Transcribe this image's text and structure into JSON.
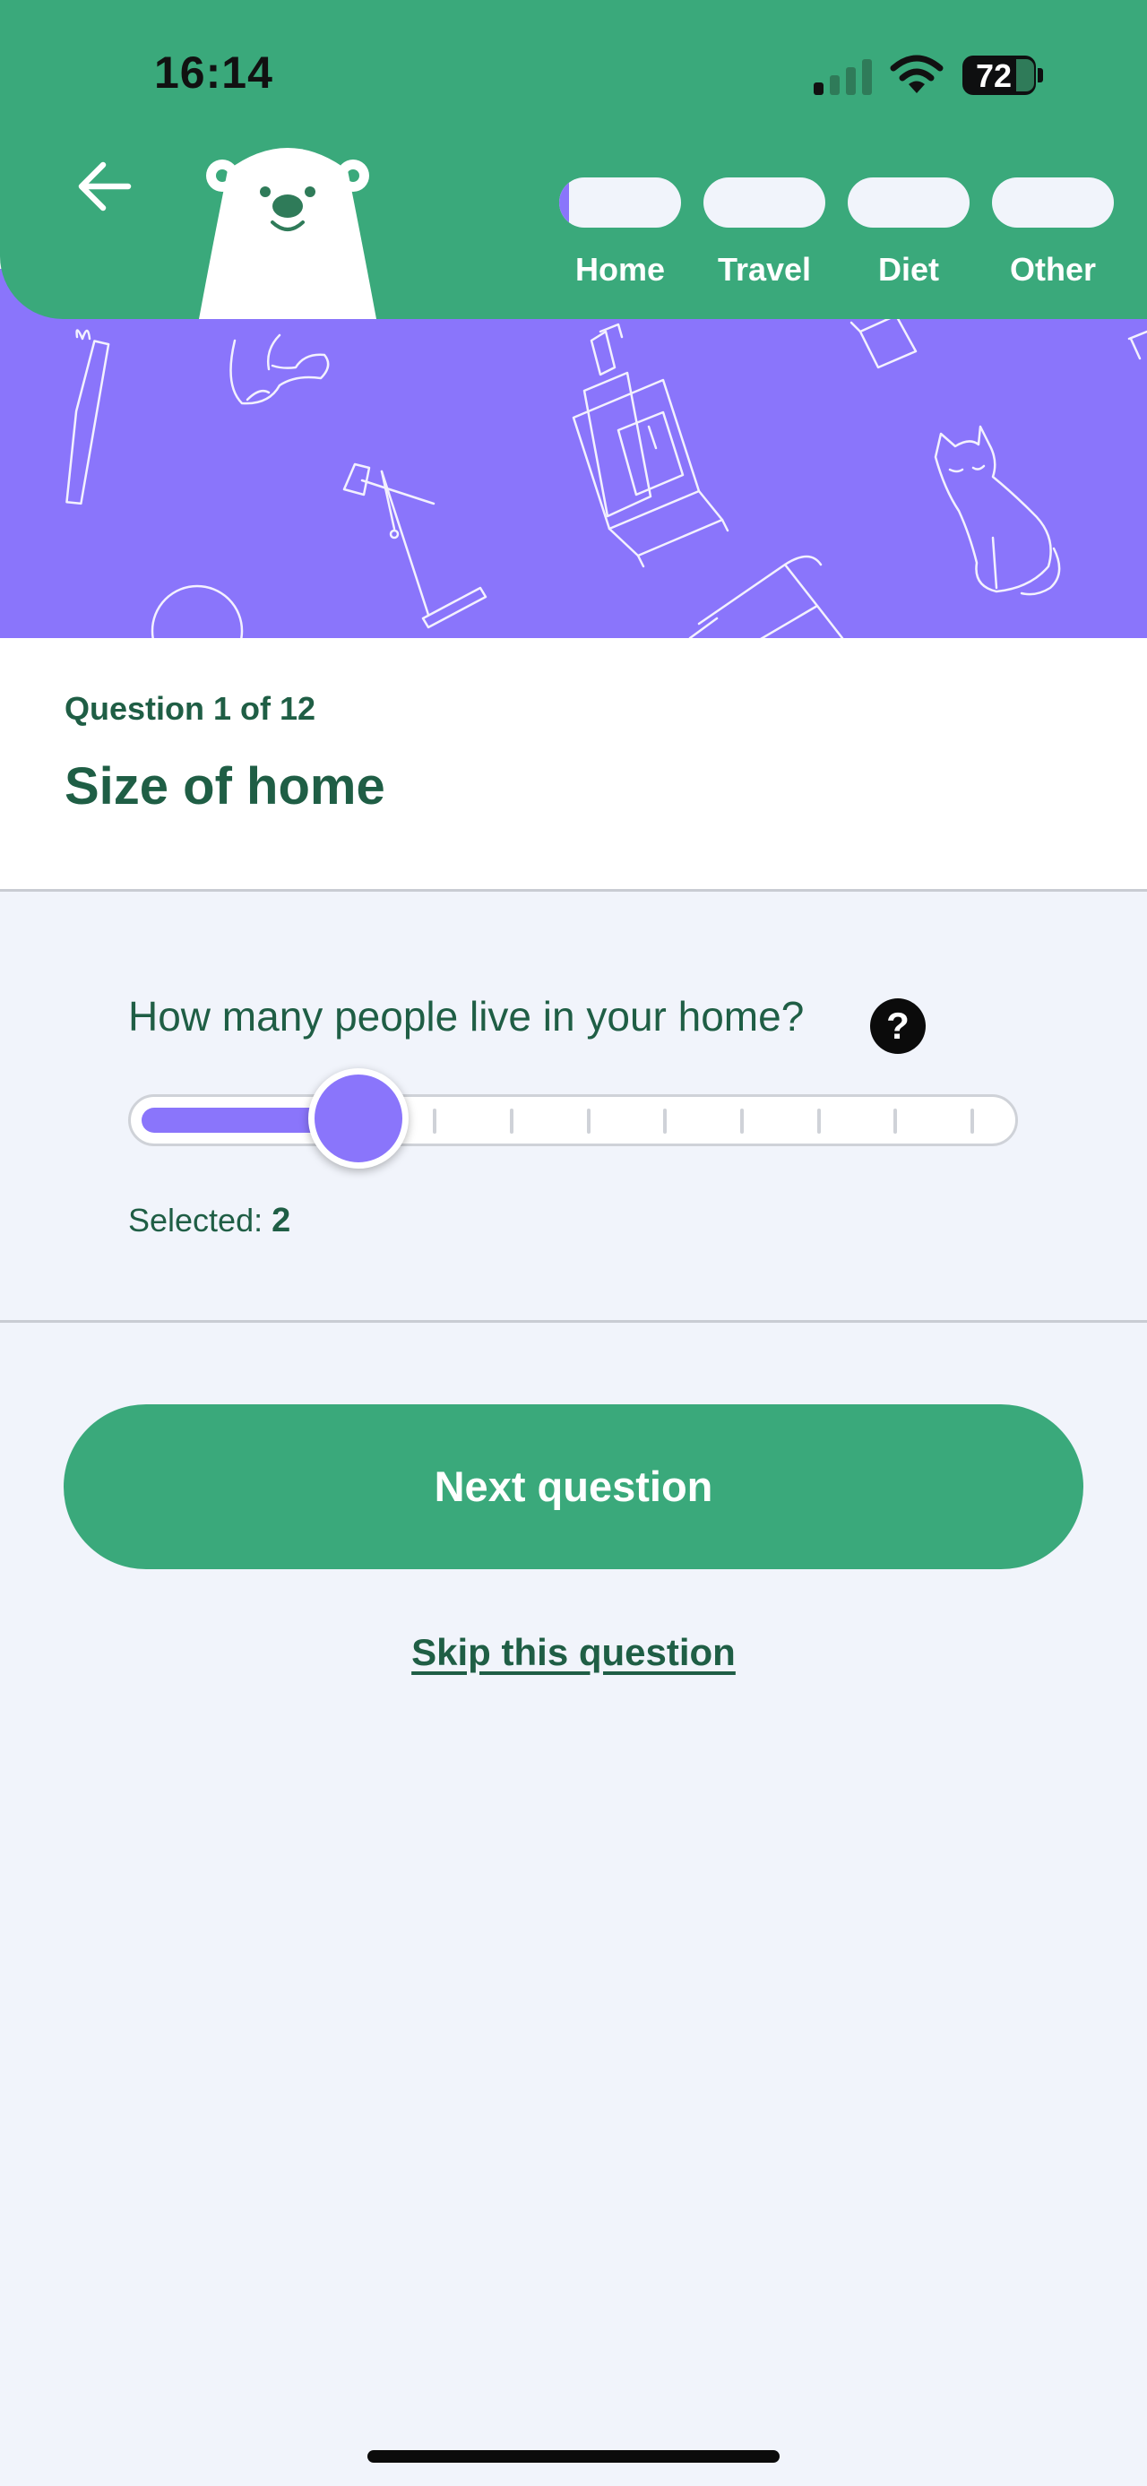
{
  "status_bar": {
    "time": "16:14",
    "battery": "72",
    "icons": [
      "cellular-signal-icon",
      "wifi-icon",
      "battery-icon"
    ]
  },
  "header": {
    "back_icon": "arrow-left-icon",
    "mascot": "polar-bear-mascot",
    "steps": [
      {
        "label": "Home",
        "progress": 0.08
      },
      {
        "label": "Travel",
        "progress": 0
      },
      {
        "label": "Diet",
        "progress": 0
      },
      {
        "label": "Other",
        "progress": 0
      }
    ]
  },
  "question": {
    "count": "Question 1 of 12",
    "title": "Size of home"
  },
  "slider": {
    "prompt": "How many people live in your home?",
    "help_icon": "question-mark-icon",
    "min": 1,
    "max": 10,
    "value": 2,
    "selected_label": "Selected: ",
    "selected_value": "2"
  },
  "actions": {
    "next_label": "Next question",
    "skip_label": "Skip this question"
  },
  "colors": {
    "brand_green": "#3aa97b",
    "accent_purple": "#8a75fb",
    "text_dark_green": "#1f5e45",
    "background": "#f1f4fb"
  }
}
